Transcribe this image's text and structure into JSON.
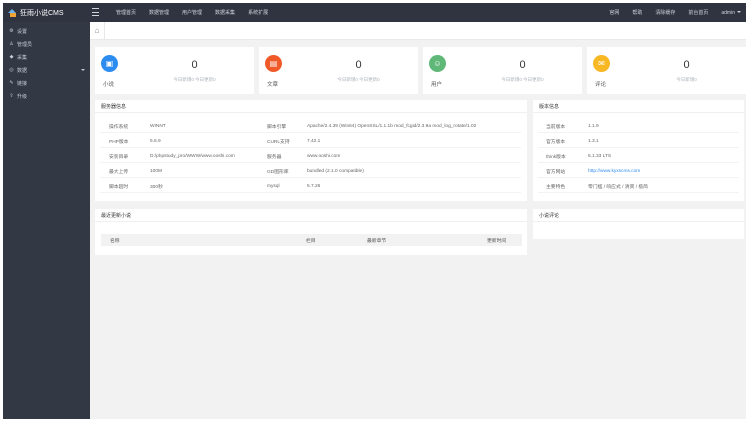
{
  "app": {
    "title": "狂雨小说CMS"
  },
  "topnav": {
    "left": [
      "管理首页",
      "数据管理",
      "用户管理",
      "数据采集",
      "系统扩展"
    ],
    "right": [
      "官网",
      "帮助",
      "清除缓存",
      "前台首页",
      "admin"
    ]
  },
  "sidebar": {
    "items": [
      {
        "icon": "⚙",
        "icon_name": "settings-icon",
        "label": "设置",
        "expandable": false
      },
      {
        "icon": "♙",
        "icon_name": "admin-user-icon",
        "label": "管理员",
        "expandable": false
      },
      {
        "icon": "◆",
        "icon_name": "collect-icon",
        "label": "采集",
        "expandable": false
      },
      {
        "icon": "◎",
        "icon_name": "data-icon",
        "label": "数据",
        "expandable": true
      },
      {
        "icon": "✎",
        "icon_name": "link-icon",
        "label": "链接",
        "expandable": false
      },
      {
        "icon": "⇪",
        "icon_name": "upgrade-icon",
        "label": "升级",
        "expandable": false
      }
    ]
  },
  "stats": [
    {
      "name": "小说",
      "icon": "▣",
      "icon_name": "novel-icon",
      "color": "#2d8cf0",
      "count": "0",
      "sub": "今日新增0 今日更新0"
    },
    {
      "name": "文章",
      "icon": "▤",
      "icon_name": "article-icon",
      "color": "#f05a28",
      "count": "0",
      "sub": "今日新增0 今日更新0"
    },
    {
      "name": "用户",
      "icon": "☺",
      "icon_name": "user-icon",
      "color": "#5fb878",
      "count": "0",
      "sub": "今日新增0 今日更新0"
    },
    {
      "name": "评论",
      "icon": "✉",
      "icon_name": "comment-icon",
      "color": "#f7b824",
      "count": "0",
      "sub": "今日新增0"
    }
  ],
  "server": {
    "title": "服务器信息",
    "rows": [
      [
        "操作系统",
        "WINNT",
        "脚本引擎",
        "Apache/2.4.39 (Win64) OpenSSL/1.1.1b mod_fcgid/2.3.9a mod_log_rotate/1.02"
      ],
      [
        "PHP版本",
        "5.6.9",
        "CURL支持",
        "7.42.1"
      ],
      [
        "安装目录",
        "D:/phpstudy_pro/WWW/www.ooshi.com",
        "服务器",
        "www.ooshi.com"
      ],
      [
        "最大上传",
        "100M",
        "GD图形库",
        "bundled (2.1.0 compatible)"
      ],
      [
        "脚本超时",
        "300秒",
        "mysql",
        "5.7.26"
      ]
    ]
  },
  "version": {
    "title": "版本信息",
    "rows": [
      [
        "当前版本",
        "1.1.9"
      ],
      [
        "官方版本",
        "1.3.1"
      ],
      [
        "think版本",
        "5.1.33 LTS"
      ],
      [
        "官方网站",
        "http://www.kyxscms.com"
      ],
      [
        "主要特色",
        "零门槛 / 响应式 / 清爽 / 极简"
      ]
    ]
  },
  "recent": {
    "title": "最近更新小说",
    "columns": [
      "名称",
      "栏目",
      "最新章节",
      "更新时间"
    ]
  },
  "comments": {
    "title": "小说评论"
  }
}
